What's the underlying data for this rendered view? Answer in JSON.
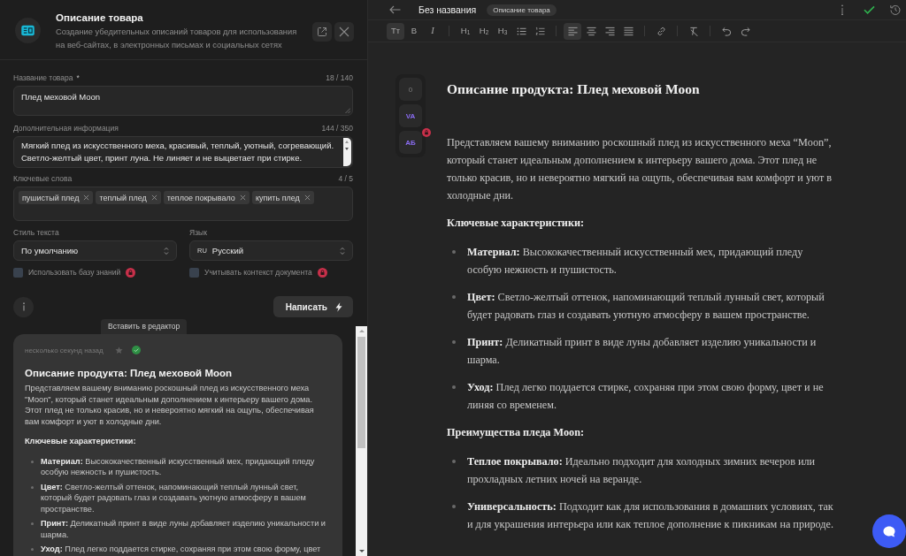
{
  "tool": {
    "title": "Описание товара",
    "description": "Создание убедительных описаний товаров для использования на веб-сайтах, в электронных письмах и социальных сетях"
  },
  "form": {
    "product_name": {
      "label": "Название товара",
      "required_mark": "*",
      "counter": "18 / 140",
      "value": "Плед меховой Moon"
    },
    "extra_info": {
      "label": "Дополнительная информация",
      "counter": "144 / 350",
      "value": "Мягкий плед из искусственного меха, красивый, теплый, уютный, согревающий. Светло-желтый цвет, принт луна. Не линяет и не выцветает при стирке."
    },
    "keywords": {
      "label": "Ключевые слова",
      "counter": "4 / 5",
      "tags": [
        "пушистый плед",
        "теплый плед",
        "теплое покрывало",
        "купить плед"
      ]
    },
    "text_style": {
      "label": "Стиль текста",
      "value": "По умолчанию"
    },
    "language": {
      "label": "Язык",
      "code": "RU",
      "value": "Русский"
    },
    "options": [
      {
        "label": "Использовать базу знаний",
        "checked": false,
        "locked": true
      },
      {
        "label": "Учитывать контекст документа",
        "checked": false,
        "locked": true
      }
    ],
    "submit": {
      "label": "Написать"
    }
  },
  "tooltip": {
    "text": "Вставить в редактор"
  },
  "result_card": {
    "time": "несколько секунд назад",
    "starred": false,
    "blocks": [
      {
        "kind": "title",
        "text": "Описание продукта: Плед меховой Moon"
      },
      {
        "kind": "paragraph",
        "text": "Представляем вашему вниманию роскошный плед из искусственного меха \"Moon\", который станет идеальным дополнением к интерьеру вашего дома. Этот плед не только красив, но и невероятно мягкий на ощупь, обеспечивая вам комфорт и уют в холодные дни."
      },
      {
        "kind": "heading",
        "text": "Ключевые характеристики:"
      },
      {
        "kind": "list",
        "items": [
          "**Материал:** Высококачественный искусственный мех, придающий пледу особую нежность и пушистость.",
          "**Цвет:** Светло-желтый оттенок, напоминающий теплый лунный свет, который будет радовать глаз и создавать уютную атмосферу в вашем пространстве.",
          "**Принт:** Деликатный принт в виде луны добавляет изделию уникальности и шарма.",
          "**Уход:** Плед легко поддается стирке, сохраняя при этом свою форму, цвет"
        ]
      }
    ]
  },
  "editor": {
    "title": "Без названия",
    "badge": "Описание товара",
    "toolbar": [
      [
        {
          "kind": "text-size",
          "label": "Tт",
          "selected": true
        },
        {
          "kind": "bold",
          "label": "B",
          "selected": false
        },
        {
          "kind": "italic",
          "label": "I",
          "selected": false
        }
      ],
      [
        {
          "kind": "heading",
          "label": "H$_{1}$",
          "selected": false
        },
        {
          "kind": "heading",
          "label": "H$_{2}$",
          "selected": false
        },
        {
          "kind": "heading",
          "label": "H$_{3}$",
          "selected": false
        },
        {
          "kind": "bullet-list",
          "selected": false
        },
        {
          "kind": "numbered-list",
          "selected": false
        }
      ],
      [
        {
          "kind": "align-left",
          "selected": true
        },
        {
          "kind": "align-center",
          "selected": false
        },
        {
          "kind": "align-right",
          "selected": false
        },
        {
          "kind": "align-justify",
          "selected": false
        }
      ],
      [
        {
          "kind": "link",
          "selected": false
        }
      ],
      [
        {
          "kind": "clear-format",
          "selected": false
        }
      ],
      [
        {
          "kind": "undo",
          "selected": false
        },
        {
          "kind": "redo",
          "selected": false
        }
      ]
    ],
    "side_tools": [
      {
        "label": "0",
        "disabled": true,
        "locked": false
      },
      {
        "label": "VA",
        "disabled": false,
        "locked": false
      },
      {
        "label": "AБ",
        "disabled": false,
        "locked": true
      }
    ],
    "blocks": [
      {
        "kind": "title",
        "text": "Описание продукта: Плед меховой Moon"
      },
      {
        "kind": "paragraph",
        "text": "Представляем вашему вниманию роскошный плед из искусственного меха “Moon”, который станет идеальным дополнением к интерьеру вашего дома. Этот плед не только красив, но и невероятно мягкий на ощупь, обеспечивая вам комфорт и уют в холодные дни."
      },
      {
        "kind": "heading",
        "text": "Ключевые характеристики:"
      },
      {
        "kind": "list",
        "items": [
          "**Материал:** Высококачественный искусственный мех, придающий пледу особую нежность и пушистость.",
          "**Цвет:** Светло-желтый оттенок, напоминающий теплый лунный свет, который будет радовать глаз и создавать уютную атмосферу в вашем пространстве.",
          "**Принт:** Деликатный принт в виде луны добавляет изделию уникальности и шарма.",
          "**Уход:** Плед легко поддается стирке, сохраняя при этом свою форму, цвет и не линяя со временем."
        ]
      },
      {
        "kind": "heading",
        "text": "Преимущества пледа Moon:"
      },
      {
        "kind": "list",
        "items": [
          "**Теплое покрывало:** Идеально подходит для холодных зимних вечеров или прохладных летних ночей на веранде.",
          "**Универсальность:** Подходит как для использования в домашних условиях, так и для украшения интерьера или как теплое дополнение к пикникам на природе."
        ]
      }
    ]
  }
}
